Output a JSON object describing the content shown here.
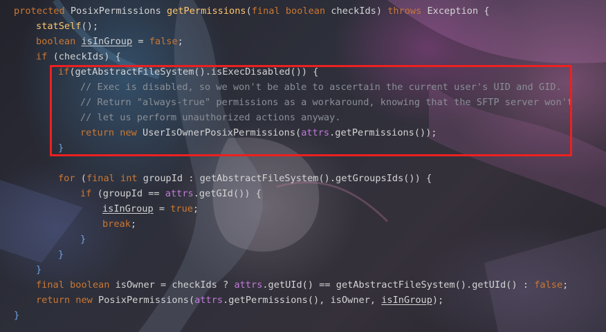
{
  "code_editor": {
    "language": "Java",
    "lines": [
      {
        "indent": 0,
        "tokens": [
          {
            "t": "protected ",
            "c": "kw"
          },
          {
            "t": "PosixPermissions ",
            "c": "txt"
          },
          {
            "t": "getPermissions",
            "c": "fn"
          },
          {
            "t": "(",
            "c": "txt"
          },
          {
            "t": "final ",
            "c": "kw"
          },
          {
            "t": "boolean ",
            "c": "kw"
          },
          {
            "t": "checkIds) ",
            "c": "txt"
          },
          {
            "t": "throws ",
            "c": "kw"
          },
          {
            "t": "Exception {",
            "c": "txt"
          }
        ]
      },
      {
        "indent": 1,
        "tokens": [
          {
            "t": "statSelf",
            "c": "fn"
          },
          {
            "t": "();",
            "c": "txt"
          }
        ]
      },
      {
        "indent": 1,
        "tokens": [
          {
            "t": "boolean ",
            "c": "kw"
          },
          {
            "t": "isInGroup",
            "c": "var"
          },
          {
            "t": " = ",
            "c": "txt"
          },
          {
            "t": "false",
            "c": "kw"
          },
          {
            "t": ";",
            "c": "txt"
          }
        ]
      },
      {
        "indent": 1,
        "tokens": [
          {
            "t": "if ",
            "c": "kw"
          },
          {
            "t": "(checkIds) {",
            "c": "txt"
          }
        ]
      },
      {
        "indent": 2,
        "tokens": [
          {
            "t": "if",
            "c": "kw"
          },
          {
            "t": "(getAbstractFileSystem().isExecDisabled()) {",
            "c": "txt"
          }
        ]
      },
      {
        "indent": 3,
        "tokens": [
          {
            "t": "// Exec is disabled, so we won't be able to ascertain the current user's UID and GID.",
            "c": "cm"
          }
        ]
      },
      {
        "indent": 3,
        "tokens": [
          {
            "t": "// Return \"always-true\" permissions as a workaround, knowing that the SFTP server won't",
            "c": "cm"
          }
        ]
      },
      {
        "indent": 3,
        "tokens": [
          {
            "t": "// let us perform unauthorized actions anyway.",
            "c": "cm"
          }
        ]
      },
      {
        "indent": 3,
        "tokens": [
          {
            "t": "return new ",
            "c": "kw"
          },
          {
            "t": "UserIsOwnerPosixPermissions(",
            "c": "txt"
          },
          {
            "t": "attrs",
            "c": "fld"
          },
          {
            "t": ".getPermissions());",
            "c": "txt"
          }
        ]
      },
      {
        "indent": 2,
        "tokens": [
          {
            "t": "}",
            "c": "brc"
          }
        ]
      },
      {
        "indent": 0,
        "tokens": []
      },
      {
        "indent": 2,
        "tokens": [
          {
            "t": "for ",
            "c": "kw"
          },
          {
            "t": "(",
            "c": "txt"
          },
          {
            "t": "final int ",
            "c": "kw"
          },
          {
            "t": "groupId : getAbstractFileSystem().getGroupsIds()) {",
            "c": "txt"
          }
        ]
      },
      {
        "indent": 3,
        "tokens": [
          {
            "t": "if ",
            "c": "kw"
          },
          {
            "t": "(groupId == ",
            "c": "txt"
          },
          {
            "t": "attrs",
            "c": "fld"
          },
          {
            "t": ".getGId()) {",
            "c": "txt"
          }
        ]
      },
      {
        "indent": 4,
        "tokens": [
          {
            "t": "isInGroup",
            "c": "var"
          },
          {
            "t": " = ",
            "c": "txt"
          },
          {
            "t": "true",
            "c": "kw"
          },
          {
            "t": ";",
            "c": "txt"
          }
        ]
      },
      {
        "indent": 4,
        "tokens": [
          {
            "t": "break",
            "c": "kw"
          },
          {
            "t": ";",
            "c": "txt"
          }
        ]
      },
      {
        "indent": 3,
        "tokens": [
          {
            "t": "}",
            "c": "brc"
          }
        ]
      },
      {
        "indent": 2,
        "tokens": [
          {
            "t": "}",
            "c": "brc"
          }
        ]
      },
      {
        "indent": 1,
        "tokens": [
          {
            "t": "}",
            "c": "brc"
          }
        ]
      },
      {
        "indent": 1,
        "tokens": [
          {
            "t": "final boolean ",
            "c": "kw"
          },
          {
            "t": "isOwner = checkIds ? ",
            "c": "txt"
          },
          {
            "t": "attrs",
            "c": "fld"
          },
          {
            "t": ".getUId() == getAbstractFileSystem().getUId() : ",
            "c": "txt"
          },
          {
            "t": "false",
            "c": "kw"
          },
          {
            "t": ";",
            "c": "txt"
          }
        ]
      },
      {
        "indent": 1,
        "tokens": [
          {
            "t": "return new ",
            "c": "kw"
          },
          {
            "t": "PosixPermissions(",
            "c": "txt"
          },
          {
            "t": "attrs",
            "c": "fld"
          },
          {
            "t": ".getPermissions(), isOwner, ",
            "c": "txt"
          },
          {
            "t": "isInGroup",
            "c": "var"
          },
          {
            "t": ");",
            "c": "txt"
          }
        ]
      },
      {
        "indent": 0,
        "tokens": [
          {
            "t": "}",
            "c": "brc"
          }
        ]
      }
    ]
  },
  "annotation": {
    "box_color": "#ee2020",
    "highlighted_lines": "5-10"
  },
  "colors": {
    "keyword": "#cc7832",
    "method": "#ffc66d",
    "field": "#c07ad8",
    "comment": "#8a8f96",
    "text": "#d4d4d4",
    "brace": "#6fa3e0"
  }
}
